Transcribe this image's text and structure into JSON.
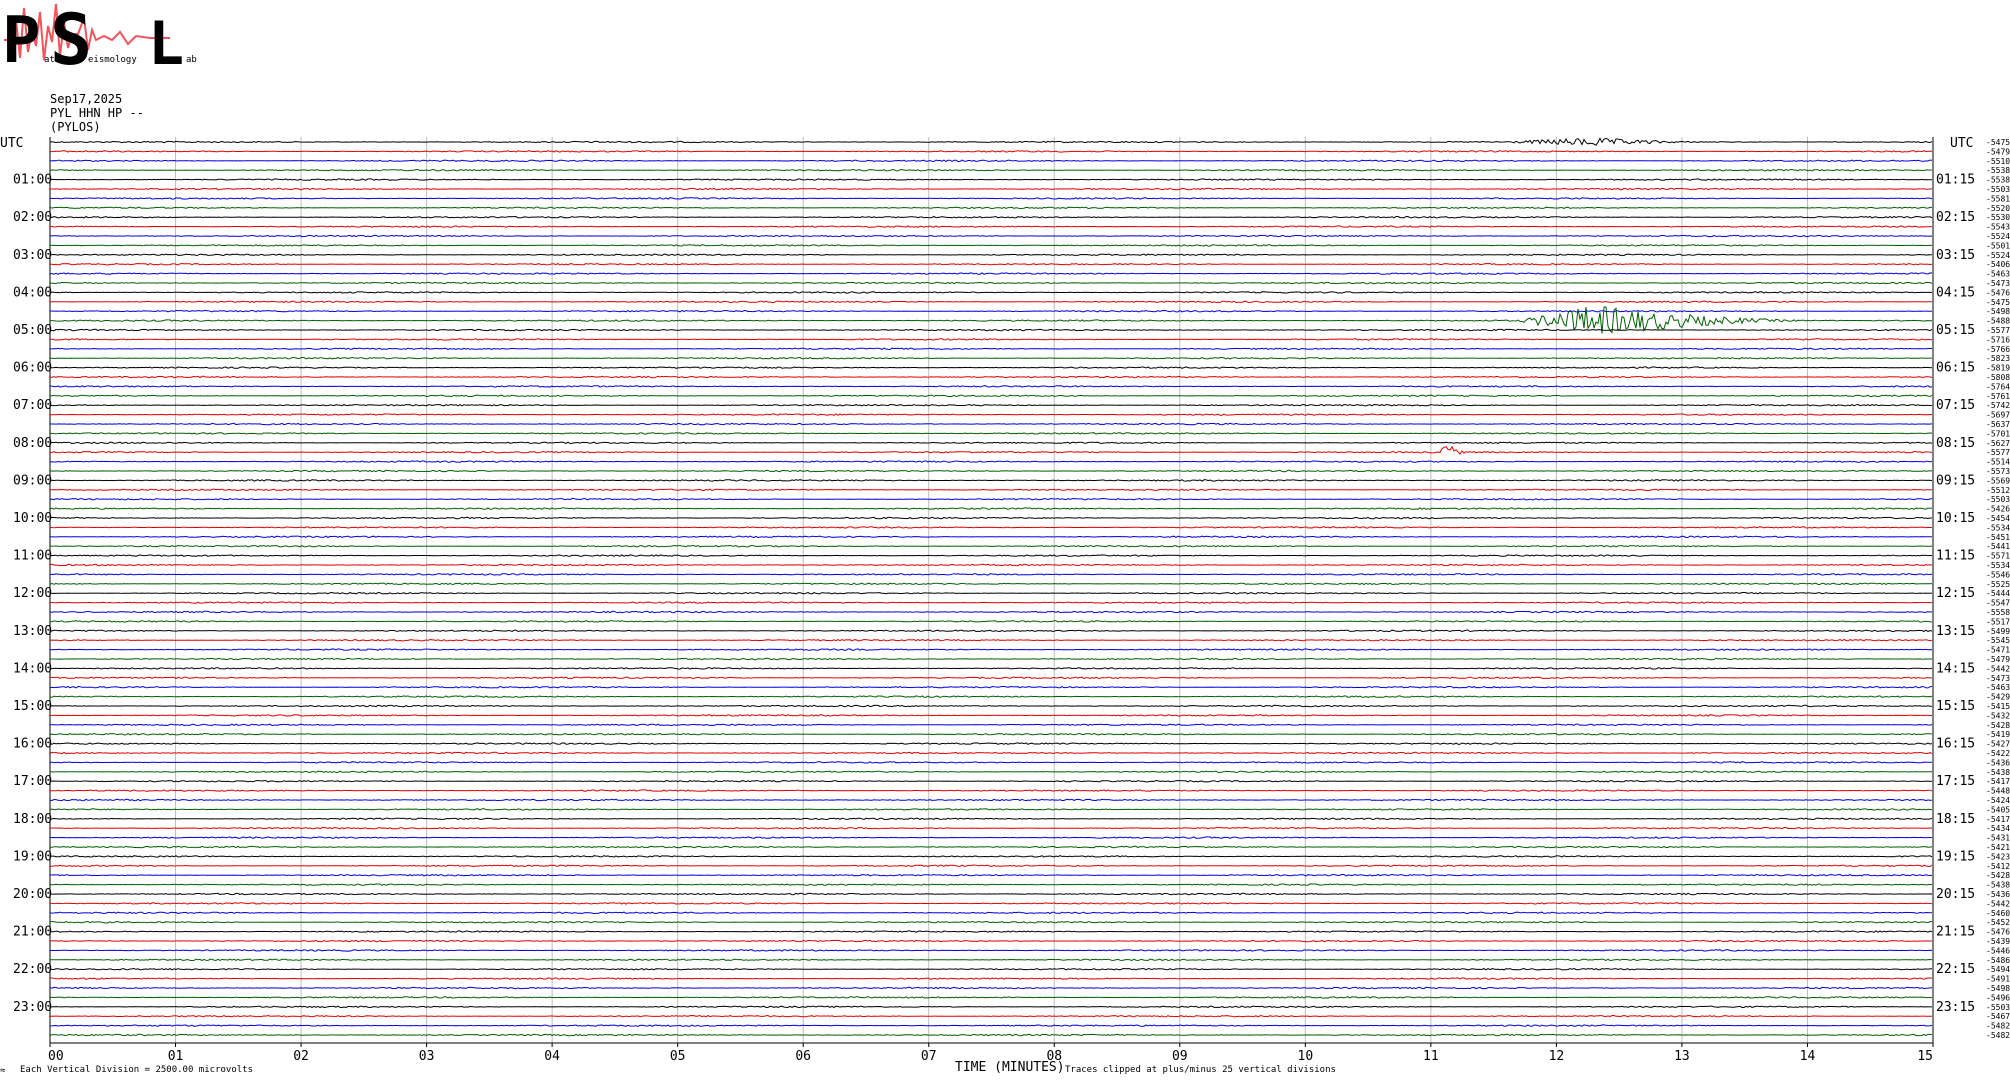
{
  "logo": {
    "letters": [
      "P",
      "S",
      "L"
    ],
    "sub_left": "atras",
    "sub_mid": "eismology",
    "sub_right": "ab",
    "color_text": "#19a9d9",
    "color_trace": "#f2545b"
  },
  "header": {
    "date": "Sep17,2025",
    "channel": "PYL HHN HP --",
    "station": "(PYLOS)"
  },
  "footer": {
    "left_mark": "≈",
    "scale_note": "Each Vertical Division = 2500.00 microvolts",
    "time_axis_label": "TIME (MINUTES)",
    "clip_note": "Traces clipped at plus/minus 25 vertical divisions"
  },
  "chart_data": {
    "type": "line",
    "title": "",
    "xlabel": "TIME (MINUTES)",
    "x_ticks": [
      "00",
      "01",
      "02",
      "03",
      "04",
      "05",
      "06",
      "07",
      "08",
      "09",
      "10",
      "11",
      "12",
      "13",
      "14",
      "15"
    ],
    "xlim": [
      0,
      15
    ],
    "rows_per_hour": 4,
    "trace_colors": [
      "#000000",
      "#e00000",
      "#0000e0",
      "#006000"
    ],
    "grid_color": "#bdbdbd",
    "left_corner_label": "UTC",
    "right_corner_label": "UTC",
    "hour_labels_left": [
      "01:00",
      "02:00",
      "03:00",
      "04:00",
      "05:00",
      "06:00",
      "07:00",
      "08:00",
      "09:00",
      "10:00",
      "11:00",
      "12:00",
      "13:00",
      "14:00",
      "15:00",
      "16:00",
      "17:00",
      "18:00",
      "19:00",
      "20:00",
      "21:00",
      "22:00",
      "23:00"
    ],
    "hour_labels_right": [
      "01:15",
      "02:15",
      "03:15",
      "04:15",
      "05:15",
      "06:15",
      "07:15",
      "08:15",
      "09:15",
      "10:15",
      "11:15",
      "12:15",
      "13:15",
      "14:15",
      "15:15",
      "16:15",
      "17:15",
      "18:15",
      "19:15",
      "20:15",
      "21:15",
      "22:15",
      "23:15"
    ],
    "row_offsets": [
      "-5475",
      "-5479",
      "-5510",
      "-5538",
      "-5538",
      "-5503",
      "-5581",
      "-5520",
      "-5530",
      "-5543",
      "-5524",
      "-5501",
      "-5524",
      "-5406",
      "-5463",
      "-5473",
      "-5476",
      "-5475",
      "-5498",
      "-5488",
      "-5577",
      "-5716",
      "-5766",
      "-5823",
      "-5819",
      "-5808",
      "-5764",
      "-5761",
      "-5742",
      "-5697",
      "-5637",
      "-5701",
      "-5627",
      "-5577",
      "-5514",
      "-5573",
      "-5569",
      "-5512",
      "-5503",
      "-5426",
      "-5454",
      "-5534",
      "-5451",
      "-5441",
      "-5571",
      "-5534",
      "-5546",
      "-5525",
      "-5444",
      "-5547",
      "-5558",
      "-5517",
      "-5499",
      "-5545",
      "-5471",
      "-5479",
      "-5442",
      "-5473",
      "-5463",
      "-5429",
      "-5415",
      "-5432",
      "-5428",
      "-5419",
      "-5427",
      "-5422",
      "-5436",
      "-5438",
      "-5417",
      "-5448",
      "-5424",
      "-5405",
      "-5417",
      "-5434",
      "-5431",
      "-5421",
      "-5423",
      "-5412",
      "-5428",
      "-5438",
      "-5436",
      "-5442",
      "-5460",
      "-5452",
      "-5476",
      "-5439",
      "-5446",
      "-5486",
      "-5494",
      "-5491",
      "-5498",
      "-5496",
      "-5503",
      "-5467",
      "-5482",
      "-5482"
    ],
    "noise_amplitude_divisions": 0.25,
    "events": [
      {
        "row": 0,
        "start_min": 11.6,
        "end_min": 13.3,
        "peak_min": 12.3,
        "amplitude": 1.2
      },
      {
        "row": 19,
        "start_min": 11.7,
        "end_min": 14.3,
        "peak_min": 12.3,
        "amplitude": 5.0
      },
      {
        "row": 33,
        "start_min": 11.05,
        "end_min": 11.3,
        "peak_min": 11.12,
        "amplitude": 3.0
      }
    ]
  }
}
